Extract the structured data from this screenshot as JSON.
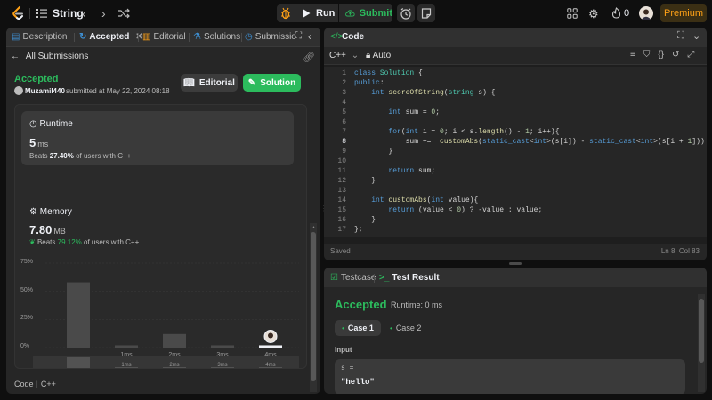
{
  "topbar": {
    "problem_list_title": "String",
    "run_label": "Run",
    "submit_label": "Submit",
    "streak_count": "0",
    "premium_label": "Premium"
  },
  "left_tabs": [
    {
      "label": "Description"
    },
    {
      "label": "Accepted"
    },
    {
      "label": "Editorial"
    },
    {
      "label": "Solutions"
    },
    {
      "label": "Submissio"
    }
  ],
  "submission": {
    "back_label": "All Submissions",
    "status": "Accepted",
    "username": "Muzamil440",
    "submitted_text": "submitted at May 22, 2024 08:18",
    "editorial_btn": "Editorial",
    "solution_btn": "Solution"
  },
  "runtime": {
    "label": "Runtime",
    "value": "5",
    "unit": "ms",
    "beats_prefix": "Beats",
    "beats_pct": "27.40%",
    "beats_suffix": "of users with C++"
  },
  "memory": {
    "label": "Memory",
    "value": "7.80",
    "unit": "MB",
    "beats_prefix": "Beats",
    "beats_pct": "79.12%",
    "beats_suffix": "of users with C++"
  },
  "chart_data": {
    "type": "bar",
    "categories": [
      "",
      "1ms",
      "2ms",
      "3ms",
      "4ms"
    ],
    "values": [
      58,
      2,
      12,
      2,
      2
    ],
    "yticks": [
      "75%",
      "50%",
      "25%",
      "0%"
    ],
    "ylim": [
      0,
      75
    ],
    "highlight_category": "4ms",
    "minimap_labels": [
      "1ms",
      "2ms",
      "3ms",
      "4ms"
    ],
    "minimap_values": [
      14,
      3,
      3,
      3,
      3
    ]
  },
  "left_footer": {
    "code_label": "Code",
    "lang_label": "C++"
  },
  "editor": {
    "title": "Code",
    "language": "C++",
    "mode": "Auto",
    "saved": "Saved",
    "cursor": "Ln 8, Col 83",
    "current_line": 8
  },
  "result": {
    "tab_testcase": "Testcase",
    "tab_result": "Test Result",
    "status": "Accepted",
    "runtime": "Runtime: 0 ms",
    "case1": "Case 1",
    "case2": "Case 2",
    "input_label": "Input",
    "input_name": "s =",
    "input_value": "\"hello\""
  },
  "colors": {
    "accent_green": "#2cbb5d",
    "premium_orange": "#ffa116",
    "background": "#0f0f0f",
    "panel": "#262626"
  }
}
